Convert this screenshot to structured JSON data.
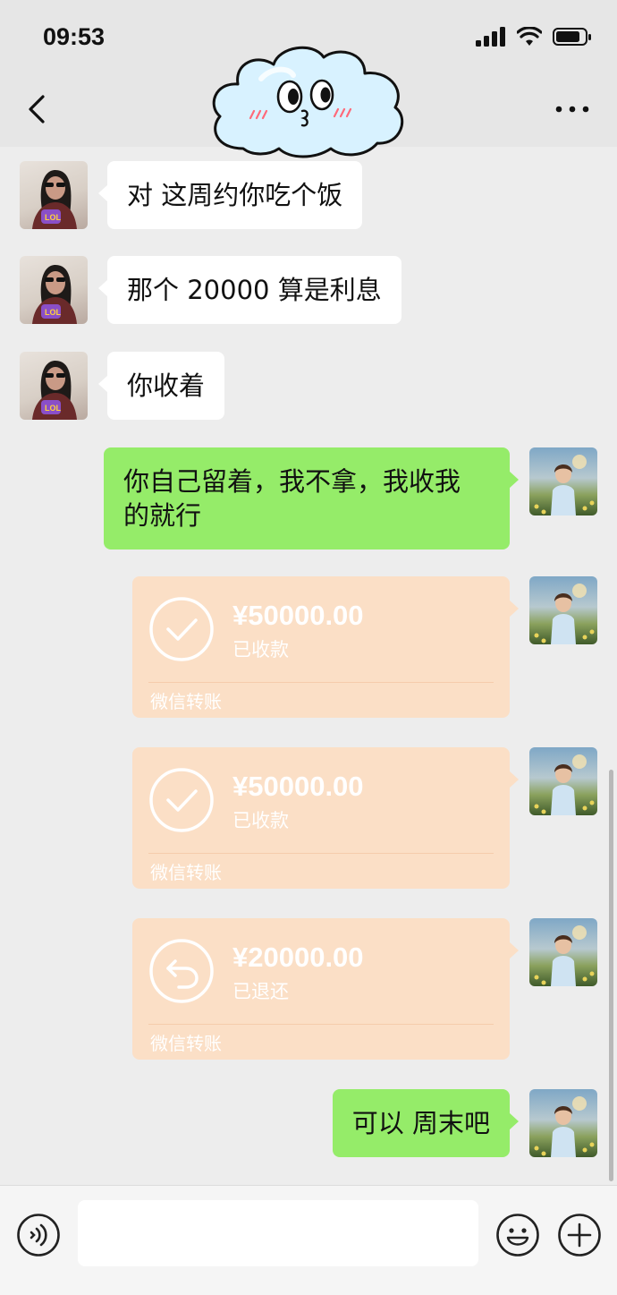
{
  "status_bar": {
    "time": "09:53"
  },
  "nav": {
    "back_icon": "chevron-left-icon",
    "more_icon": "more-dots-icon",
    "sticker": "cloud-face-sticker"
  },
  "messages": [
    {
      "side": "left",
      "type": "text",
      "text": "对 这周约你吃个饭"
    },
    {
      "side": "left",
      "type": "text",
      "text": "那个 20000 算是利息"
    },
    {
      "side": "left",
      "type": "text",
      "text": "你收着"
    },
    {
      "side": "right",
      "type": "text",
      "line1": "你自己留着，我不拿，我收我",
      "line2": "的就行"
    },
    {
      "side": "right",
      "type": "transfer",
      "amount": "¥50000.00",
      "status": "已收款",
      "label": "微信转账",
      "icon": "check-circle-icon"
    },
    {
      "side": "right",
      "type": "transfer",
      "amount": "¥50000.00",
      "status": "已收款",
      "label": "微信转账",
      "icon": "check-circle-icon"
    },
    {
      "side": "right",
      "type": "transfer",
      "amount": "¥20000.00",
      "status": "已退还",
      "label": "微信转账",
      "icon": "return-circle-icon"
    },
    {
      "side": "right",
      "type": "text",
      "text": "可以 周末吧"
    }
  ],
  "input_bar": {
    "value": "",
    "voice_icon": "voice-icon",
    "emoji_icon": "emoji-icon",
    "plus_icon": "plus-icon"
  },
  "colors": {
    "sent_bubble": "#95ec69",
    "received_bubble": "#ffffff",
    "transfer_bg": "#fbdfc6",
    "chat_bg": "#ededed",
    "header_bg": "#e6e6e6"
  }
}
